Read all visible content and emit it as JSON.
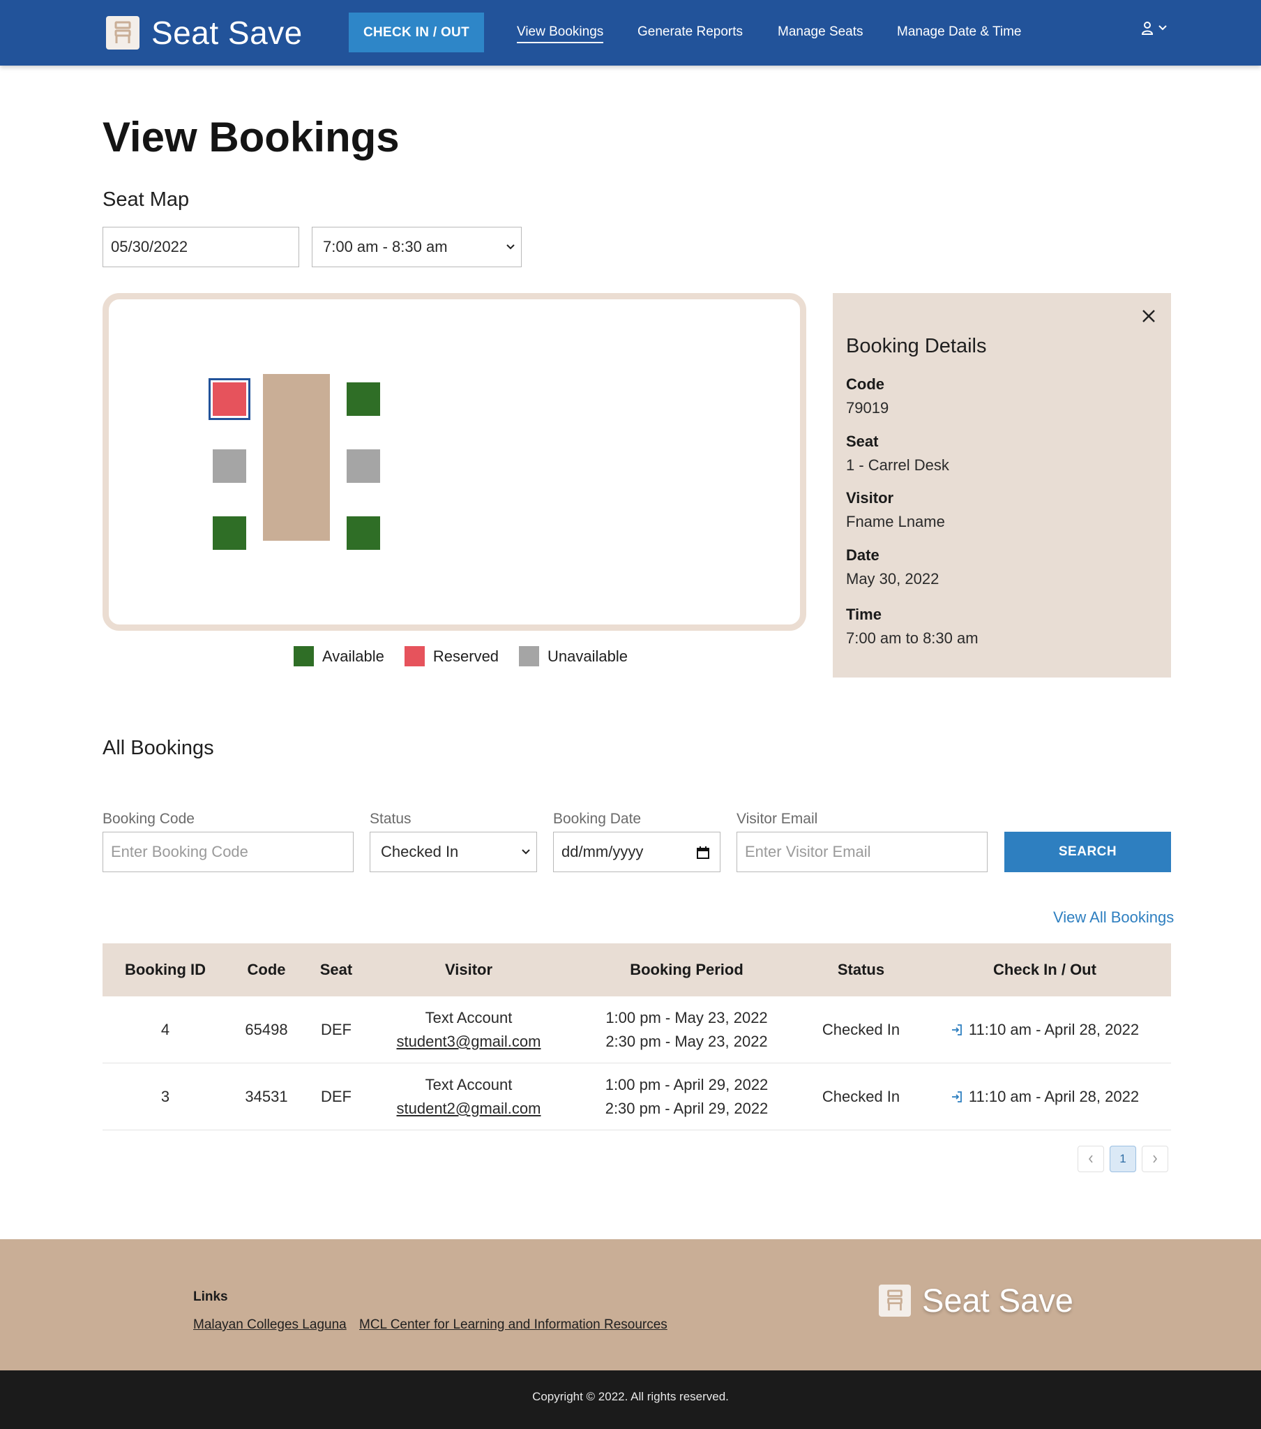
{
  "app": {
    "brand": "Seat Save"
  },
  "nav": {
    "checkin_button": "CHECK IN / OUT",
    "links": [
      {
        "label": "View Bookings"
      },
      {
        "label": "Generate Reports"
      },
      {
        "label": "Manage Seats"
      },
      {
        "label": "Manage Date & Time"
      }
    ],
    "user_icon": "user-icon"
  },
  "page": {
    "title": "View Bookings"
  },
  "seat_map": {
    "title": "Seat Map",
    "date_value": "05/30/2022",
    "time_value": "7:00 am - 8:30 am",
    "colors": {
      "available": "#2f6e26",
      "reserved": "#e6535c",
      "unavailable": "#a5a5a5",
      "desk": "#c9ae96"
    },
    "legend": {
      "available": "Available",
      "reserved": "Reserved",
      "unavailable": "Unavailable"
    }
  },
  "details": {
    "title": "Booking Details",
    "code_label": "Code",
    "code_value": "79019",
    "seat_label": "Seat",
    "seat_value": "1 - Carrel Desk",
    "visitor_label": "Visitor",
    "visitor_value": "Fname Lname",
    "date_label": "Date",
    "date_value": "May 30, 2022",
    "time_label": "Time",
    "time_value": "7:00 am to 8:30 am"
  },
  "all_bookings": {
    "title": "All Bookings",
    "filters": {
      "code_label": "Booking Code",
      "code_placeholder": "Enter Booking Code",
      "status_label": "Status",
      "status_value": "Checked In",
      "date_label": "Booking Date",
      "date_placeholder": "dd/mm/yyyy",
      "email_label": "Visitor Email",
      "email_placeholder": "Enter Visitor Email",
      "search_button": "SEARCH"
    },
    "view_all": "View All Bookings",
    "columns": [
      "Booking ID",
      "Code",
      "Seat",
      "Visitor",
      "Booking Period",
      "Status",
      "Check In / Out"
    ],
    "rows": [
      {
        "id": "4",
        "code": "65498",
        "seat": "DEF",
        "visitor_name": "Text Account",
        "visitor_email": "student3@gmail.com",
        "period_start": "1:00 pm - May 23, 2022",
        "period_end": "2:30 pm - May 23, 2022",
        "status": "Checked In",
        "checkin": "11:10 am - April 28, 2022"
      },
      {
        "id": "3",
        "code": "34531",
        "seat": "DEF",
        "visitor_name": "Text Account",
        "visitor_email": "student2@gmail.com",
        "period_start": "1:00 pm - April 29, 2022",
        "period_end": "2:30 pm - April 29, 2022",
        "status": "Checked In",
        "checkin": "11:10 am - April 28, 2022"
      }
    ],
    "pagination": {
      "current_page": "1",
      "prev_icon": "chevron-left-icon",
      "next_icon": "chevron-right-icon"
    }
  },
  "footer": {
    "links_title": "Links",
    "links": [
      {
        "label": "Malayan Colleges Laguna"
      },
      {
        "label": "MCL Center for Learning and Information Resources"
      }
    ],
    "brand": "Seat Save",
    "copyright": "Copyright © 2022. All rights reserved."
  }
}
